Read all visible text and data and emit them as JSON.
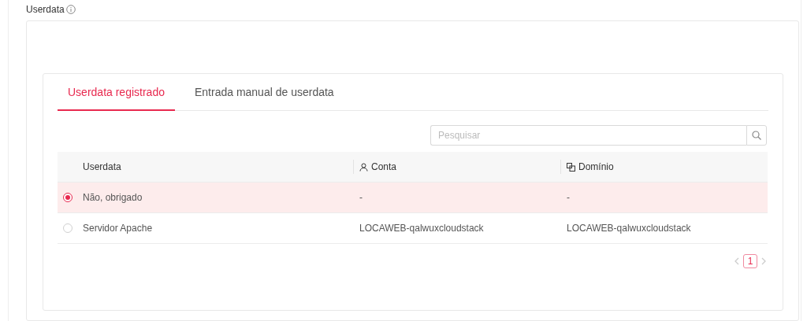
{
  "section": {
    "label": "Userdata"
  },
  "tabs": [
    {
      "label": "Userdata registrado",
      "selected": true
    },
    {
      "label": "Entrada manual de userdata",
      "selected": false
    }
  ],
  "search": {
    "placeholder": "Pesquisar"
  },
  "table": {
    "columns": [
      {
        "label": "Userdata",
        "kind": "plain"
      },
      {
        "label": "Conta",
        "kind": "user"
      },
      {
        "label": "Domínio",
        "kind": "domain"
      }
    ],
    "rows": [
      {
        "selected": true,
        "cells": [
          "Não, obrigado",
          "-",
          "-"
        ]
      },
      {
        "selected": false,
        "cells": [
          "Servidor Apache",
          "LOCAWEB-qalwuxcloudstack",
          "LOCAWEB-qalwuxcloudstack"
        ]
      }
    ]
  },
  "pagination": {
    "pages": [
      {
        "label": "1",
        "selected": true
      }
    ]
  }
}
